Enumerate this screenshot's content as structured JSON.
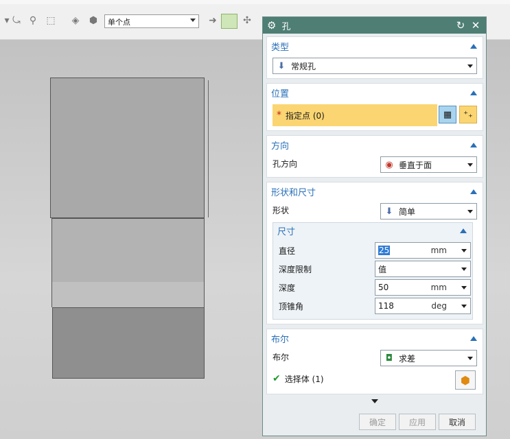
{
  "toolbar": {
    "selection_filter": "单个点"
  },
  "dialog": {
    "title": "孔",
    "type_section": {
      "title": "类型",
      "value": "常规孔"
    },
    "position_section": {
      "title": "位置",
      "point_label": "指定点 (0)",
      "required_mark": "*"
    },
    "direction_section": {
      "title": "方向",
      "label": "孔方向",
      "value": "垂直于面"
    },
    "shape_section": {
      "title": "形状和尺寸",
      "shape_label": "形状",
      "shape_value": "简单",
      "dimensions": {
        "title": "尺寸",
        "diameter_label": "直径",
        "diameter_value": "25",
        "diameter_unit": "mm",
        "depth_limit_label": "深度限制",
        "depth_limit_value": "值",
        "depth_label": "深度",
        "depth_value": "50",
        "depth_unit": "mm",
        "tip_angle_label": "顶锥角",
        "tip_angle_value": "118",
        "tip_angle_unit": "deg"
      }
    },
    "boolean_section": {
      "title": "布尔",
      "label": "布尔",
      "value": "求差",
      "select_body_label": "选择体 (1)"
    },
    "buttons": {
      "ok": "确定",
      "apply": "应用",
      "cancel": "取消"
    }
  }
}
